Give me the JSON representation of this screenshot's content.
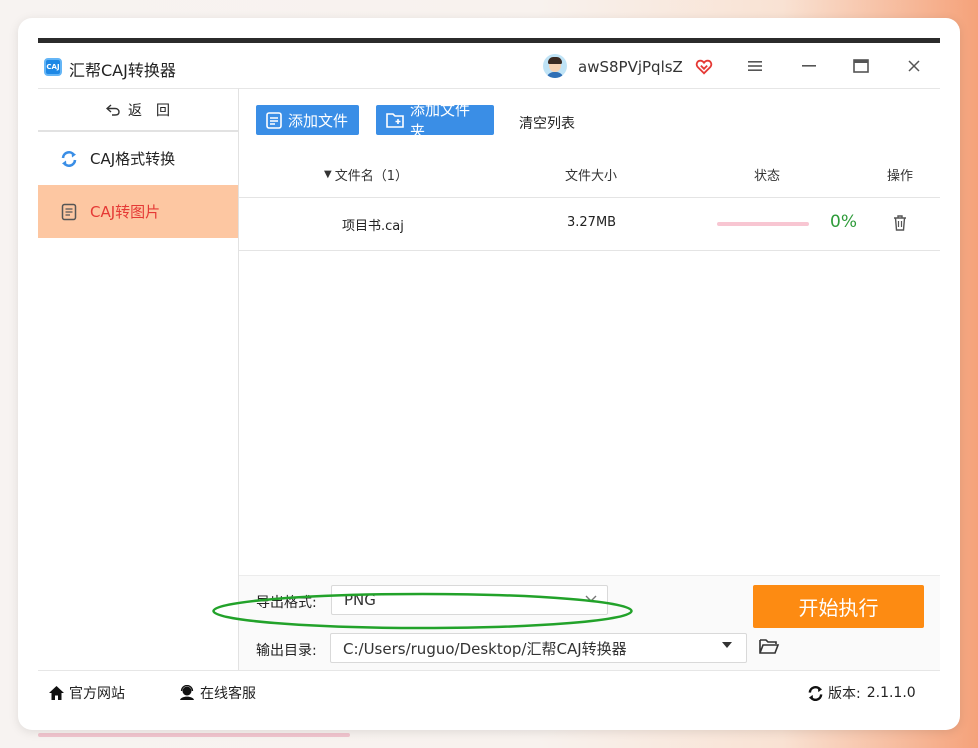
{
  "app": {
    "title": "汇帮CAJ转换器",
    "icon_label": "CAJ"
  },
  "user": {
    "name": "awS8PVjPqlsZ"
  },
  "window_controls": {
    "menu": "≡",
    "minimize": "—",
    "maximize": "□",
    "close": "×"
  },
  "sidebar": {
    "back_label": "返　回",
    "items": [
      {
        "label": "CAJ格式转换",
        "icon": "refresh-icon",
        "active": false
      },
      {
        "label": "CAJ转图片",
        "icon": "document-icon",
        "active": true
      }
    ]
  },
  "toolbar": {
    "add_file": "添加文件",
    "add_folder": "添加文件夹",
    "clear_list": "清空列表"
  },
  "table": {
    "headers": {
      "name": "文件名（1）",
      "size": "文件大小",
      "status": "状态",
      "action": "操作"
    },
    "rows": [
      {
        "name": "项目书.caj",
        "size": "3.27MB",
        "progress": 0,
        "percent": "0%"
      }
    ]
  },
  "settings": {
    "format_label": "导出格式:",
    "format_value": "PNG",
    "output_label": "输出目录:",
    "output_value": "C:/Users/ruguo/Desktop/汇帮CAJ转换器",
    "start_label": "开始执行"
  },
  "footer": {
    "website": "官方网站",
    "support": "在线客服",
    "version_label": "版本:",
    "version": "2.1.1.0"
  },
  "colors": {
    "accent_blue": "#3a8ee6",
    "start_orange": "#fd8b12",
    "active_bg": "#fdc7a2",
    "active_text": "#e53935",
    "percent_green": "#2e9b3a",
    "highlight_oval": "#22a22a"
  }
}
